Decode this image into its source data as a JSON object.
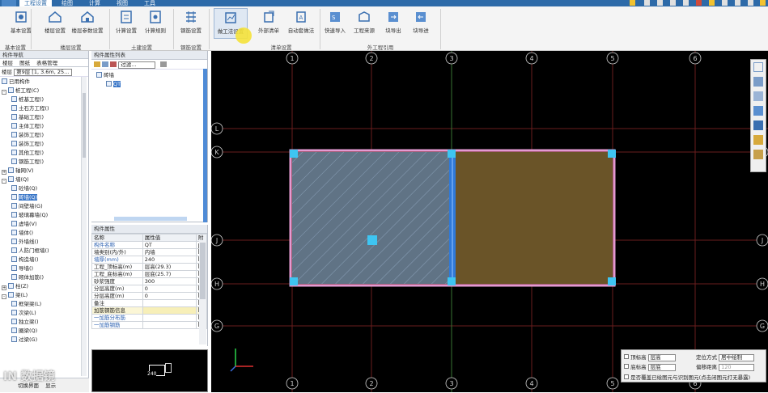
{
  "tabs": [
    {
      "label": "工程设置",
      "active": true
    },
    {
      "label": "绘图",
      "active": false
    },
    {
      "label": "计算",
      "active": false
    },
    {
      "label": "视图",
      "active": false
    },
    {
      "label": "工具",
      "active": false
    }
  ],
  "ribbon": {
    "buttons": [
      {
        "label": "基本设置",
        "icon": "settings-icon"
      },
      {
        "label": "楼层设置",
        "icon": "floor-icon"
      },
      {
        "label": "楼层参数设置",
        "icon": "floor-params-icon"
      },
      {
        "label": "计算设置",
        "icon": "calc-settings-icon"
      },
      {
        "label": "计算规则",
        "icon": "calc-rules-icon"
      },
      {
        "label": "钢筋设置",
        "icon": "rebar-icon"
      },
      {
        "label": "做工法设置",
        "icon": "method-icon"
      },
      {
        "label": "外部清单",
        "icon": "external-list-icon"
      },
      {
        "label": "自动套做法",
        "icon": "auto-apply-icon"
      },
      {
        "label": "快速导入",
        "icon": "quick-import-icon"
      },
      {
        "label": "工程来源",
        "icon": "project-source-icon"
      },
      {
        "label": "块导出",
        "icon": "block-export-icon"
      },
      {
        "label": "块导进",
        "icon": "block-import-icon"
      }
    ],
    "groups": [
      "基本设置",
      "楼层设置",
      "土建设置",
      "钢筋设置",
      "清单设置",
      "外工程引用"
    ]
  },
  "left_panel": {
    "title": "构件导航",
    "tabs": [
      "楼层",
      "图纸",
      "表格管理"
    ],
    "floor_label": "楼层",
    "floor_value": "第9层 [1, 3.6m, 25...",
    "tree": [
      {
        "label": "已用构件",
        "indent": 0,
        "toggle": ""
      },
      {
        "label": "桩工程(C)",
        "indent": 0,
        "toggle": "-"
      },
      {
        "label": "桩基工程()",
        "indent": 1,
        "toggle": ""
      },
      {
        "label": "土石方工程()",
        "indent": 1,
        "toggle": ""
      },
      {
        "label": "基础工程()",
        "indent": 1,
        "toggle": ""
      },
      {
        "label": "主体工程()",
        "indent": 1,
        "toggle": ""
      },
      {
        "label": "装饰工程()",
        "indent": 1,
        "toggle": ""
      },
      {
        "label": "装饰工程()",
        "indent": 1,
        "toggle": ""
      },
      {
        "label": "其他工程()",
        "indent": 1,
        "toggle": ""
      },
      {
        "label": "钢筋工程()",
        "indent": 1,
        "toggle": ""
      },
      {
        "label": "轴网(V)",
        "indent": 0,
        "toggle": "+"
      },
      {
        "label": "墙(Q)",
        "indent": 0,
        "toggle": "-"
      },
      {
        "label": "砼墙(Q)",
        "indent": 1,
        "toggle": ""
      },
      {
        "label": "砖墙(Q)",
        "indent": 1,
        "toggle": "",
        "selected": true
      },
      {
        "label": "间壁墙(G)",
        "indent": 1,
        "toggle": ""
      },
      {
        "label": "玻璃幕墙(Q)",
        "indent": 1,
        "toggle": ""
      },
      {
        "label": "虚墙(V)",
        "indent": 1,
        "toggle": ""
      },
      {
        "label": "墙体()",
        "indent": 1,
        "toggle": ""
      },
      {
        "label": "外墙线()",
        "indent": 1,
        "toggle": ""
      },
      {
        "label": "人防门框墙()",
        "indent": 1,
        "toggle": ""
      },
      {
        "label": "构造墙()",
        "indent": 1,
        "toggle": ""
      },
      {
        "label": "导墙()",
        "indent": 1,
        "toggle": ""
      },
      {
        "label": "砌体加筋()",
        "indent": 1,
        "toggle": ""
      },
      {
        "label": "柱(Z)",
        "indent": 0,
        "toggle": "+"
      },
      {
        "label": "梁(L)",
        "indent": 0,
        "toggle": "-"
      },
      {
        "label": "框架梁(L)",
        "indent": 1,
        "toggle": ""
      },
      {
        "label": "次梁(L)",
        "indent": 1,
        "toggle": ""
      },
      {
        "label": "独立梁()",
        "indent": 1,
        "toggle": ""
      },
      {
        "label": "圈梁(Q)",
        "indent": 1,
        "toggle": ""
      },
      {
        "label": "过梁(G)",
        "indent": 1,
        "toggle": ""
      }
    ],
    "bottom_tabs": [
      "切换界面",
      "显示"
    ]
  },
  "component_list": {
    "title": "构件属性列表",
    "filter_label": "过滤...",
    "tree": [
      {
        "label": "砖墙",
        "indent": 0
      },
      {
        "label": "QT",
        "indent": 1,
        "selected": true
      }
    ]
  },
  "properties": {
    "title": "构件属性",
    "headers": [
      "名称",
      "属性值",
      "附"
    ],
    "rows": [
      {
        "name": "构件名称",
        "value": "QT",
        "checked": true,
        "name_link": true
      },
      {
        "name": "墙类别(内/外)",
        "value": "内墙",
        "checked": false
      },
      {
        "name": "墙厚(mm)",
        "value": "240",
        "checked": false,
        "name_link": true
      },
      {
        "name": "工程_顶标高(m)",
        "value": "层高(29.3)",
        "checked": false
      },
      {
        "name": "工程_底标高(m)",
        "value": "层底(25.7)",
        "checked": false
      },
      {
        "name": "砂浆强度",
        "value": "300",
        "checked": false
      },
      {
        "name": "分层高度(m)",
        "value": "0",
        "checked": false
      },
      {
        "name": "分层高度(m)",
        "value": "0",
        "checked": false
      },
      {
        "name": "备注",
        "value": "",
        "checked": false
      },
      {
        "name": "加筋钢筋信息",
        "value": "",
        "checked": false,
        "section": true
      },
      {
        "name": "一加筋分布筋",
        "value": "",
        "checked": false,
        "name_link": true
      },
      {
        "name": "一加筋钢筋",
        "value": "",
        "checked": false,
        "name_link": true
      }
    ]
  },
  "thumbnail": {
    "label": "240"
  },
  "canvas": {
    "axis_top": [
      "1",
      "2",
      "3",
      "4",
      "5",
      "6"
    ],
    "axis_bottom": [
      "1",
      "2",
      "3",
      "4",
      "5",
      "6"
    ],
    "axis_left": [
      "L",
      "K",
      "J",
      "H",
      "G"
    ],
    "axis_right": [
      "K",
      "J",
      "H",
      "G"
    ],
    "wall_left_color": "#607385",
    "wall_right_color": "#6a5428",
    "border_color": "#e49ad2"
  },
  "options": {
    "top_label": "顶标高",
    "top_value": "层高",
    "bottom_label": "底标高",
    "bottom_value": "层底",
    "position_label": "定位方式",
    "position_value": "居中绘制",
    "offset_label": "偏移距离",
    "offset_value": "120",
    "note": "是否覆盖已绘图元与识别图元(点击闭图元打无暴露)"
  },
  "watermark": "IN 数据镜"
}
